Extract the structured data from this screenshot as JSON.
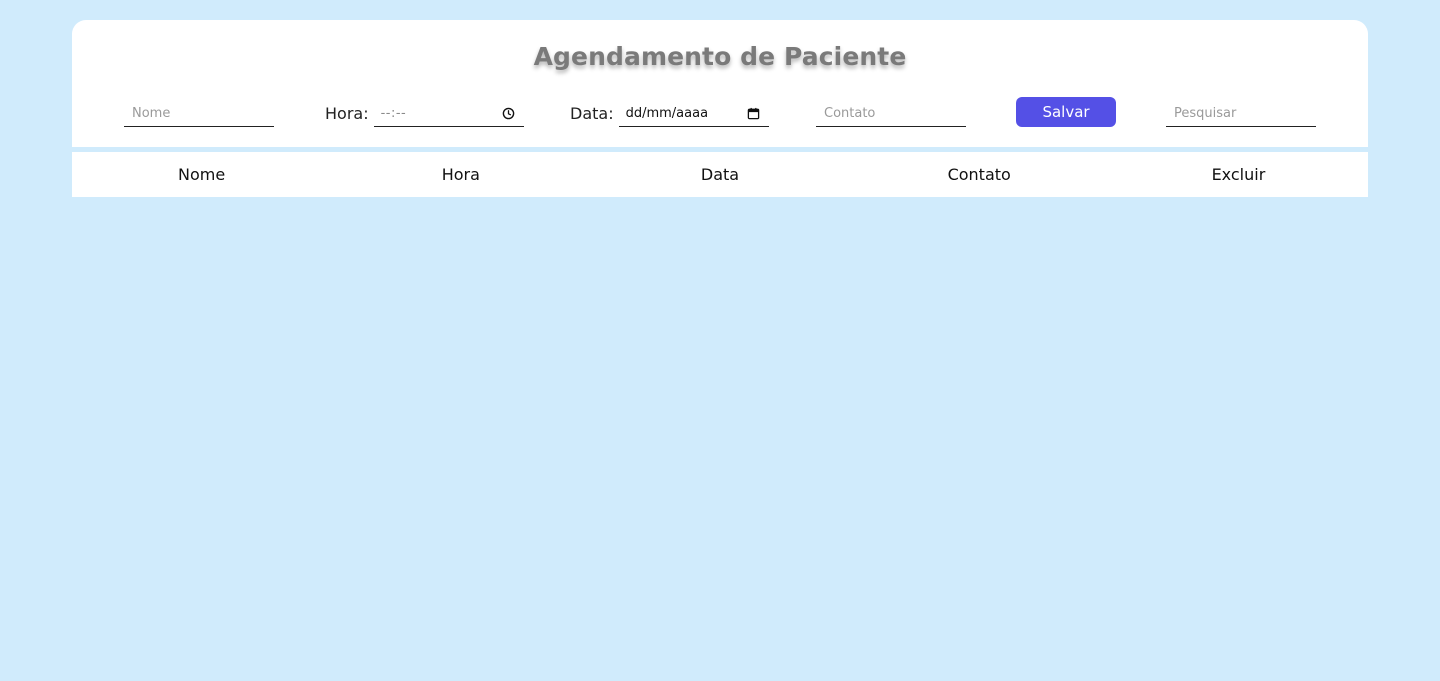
{
  "title": "Agendamento de Paciente",
  "form": {
    "nome_placeholder": "Nome",
    "hora_label": "Hora:",
    "hora_value": "--:--",
    "data_label": "Data:",
    "data_value": "dd/mm/aaaa",
    "contato_placeholder": "Contato",
    "save_label": "Salvar",
    "search_placeholder": "Pesquisar"
  },
  "table": {
    "columns": [
      "Nome",
      "Hora",
      "Data",
      "Contato",
      "Excluir"
    ],
    "rows": []
  },
  "colors": {
    "background": "#d0ebfc",
    "card": "#ffffff",
    "accent": "#5450e6",
    "title": "#7a7a7a"
  }
}
